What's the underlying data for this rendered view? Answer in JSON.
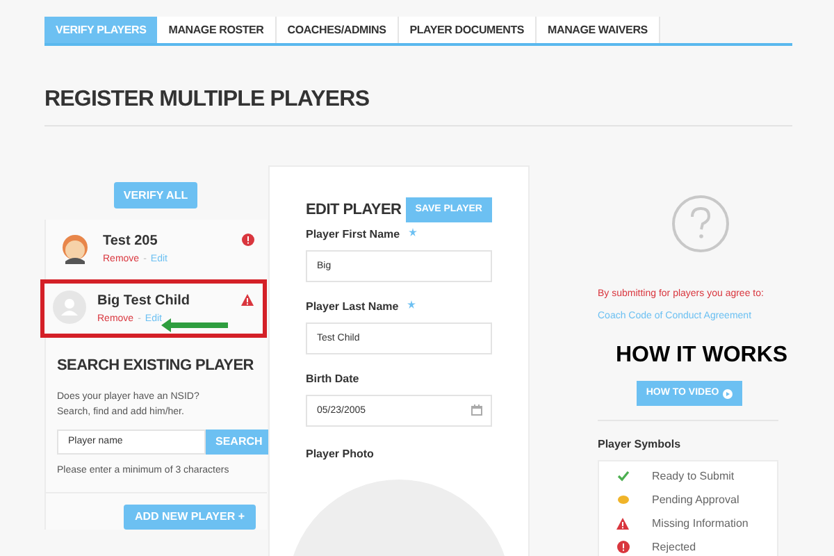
{
  "tabs": [
    {
      "label": "VERIFY PLAYERS",
      "selected": true
    },
    {
      "label": "MANAGE ROSTER",
      "selected": false
    },
    {
      "label": "COACHES/ADMINS",
      "selected": false
    },
    {
      "label": "PLAYER DOCUMENTS",
      "selected": false
    },
    {
      "label": "MANAGE WAIVERS",
      "selected": false
    }
  ],
  "page_title": "REGISTER MULTIPLE PLAYERS",
  "verify_all_button": "VERIFY ALL",
  "players": [
    {
      "name": "Test 205",
      "avatar": {
        "kind": "child"
      },
      "status": {
        "kind": "error"
      },
      "highlighted": false,
      "remove": "Remove",
      "separator": "-",
      "edit": "Edit"
    },
    {
      "name": "Big Test Child",
      "avatar": {
        "kind": "placeholder"
      },
      "status": {
        "kind": "warning"
      },
      "highlighted": true,
      "remove": "Remove",
      "separator": "-",
      "edit": "Edit"
    }
  ],
  "search_existing": {
    "title": "SEARCH EXISTING PLAYER",
    "description": "Does your player have an NSID? Search, find and add him/her.",
    "placeholder": "Player name",
    "button": "SEARCH",
    "hint": "Please enter a minimum of 3 characters"
  },
  "add_new_player_button": "ADD NEW PLAYER +",
  "edit_player": {
    "title": "EDIT PLAYER",
    "save_button": "SAVE PLAYER",
    "fields": [
      {
        "label": "Player First Name",
        "required": true,
        "value": "Big",
        "kind": "text"
      },
      {
        "label": "Player Last Name",
        "required": true,
        "value": "Test Child",
        "kind": "text"
      },
      {
        "label": "Birth Date",
        "required": false,
        "value": "05/23/2005",
        "kind": "date"
      }
    ],
    "photo_label": "Player Photo"
  },
  "agreement": {
    "notice": "By submitting for players you agree to:",
    "link": "Coach Code of Conduct Agreement"
  },
  "how_it_works": {
    "title": "HOW IT WORKS",
    "button": "HOW TO VIDEO"
  },
  "player_symbols": {
    "title": "Player Symbols",
    "items": [
      {
        "kind": "ready",
        "label": "Ready to Submit"
      },
      {
        "kind": "pending",
        "label": "Pending Approval"
      },
      {
        "kind": "missing",
        "label": "Missing Information"
      },
      {
        "kind": "rejected",
        "label": "Rejected"
      }
    ]
  }
}
